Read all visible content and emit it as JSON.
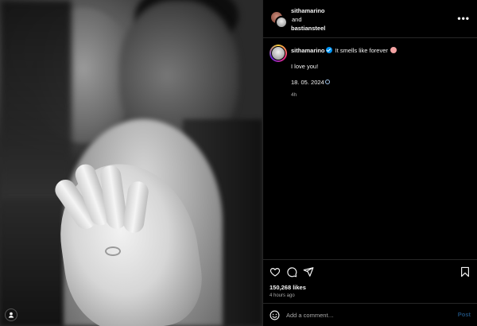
{
  "post": {
    "collab_user_1": "sithamarino",
    "collab_and": "and",
    "collab_user_2": "bastiansteel",
    "more_label": "•••"
  },
  "caption": {
    "username": "sithamarino",
    "text": "It smells like forever",
    "line2": "I love you!",
    "date": "18. 05. 2024",
    "time": "4h"
  },
  "stats": {
    "likes": "150,268 likes",
    "posted": "4 hours ago"
  },
  "comment": {
    "placeholder": "Add a comment…",
    "post_label": "Post"
  },
  "colors": {
    "accent": "#0095f6",
    "background": "#000000",
    "divider": "#262626",
    "muted_text": "#a8a8a8"
  },
  "icons": [
    "heart-icon",
    "comment-icon",
    "share-icon",
    "bookmark-icon",
    "emoji-icon",
    "more-icon",
    "verified-icon",
    "profile-icon"
  ]
}
